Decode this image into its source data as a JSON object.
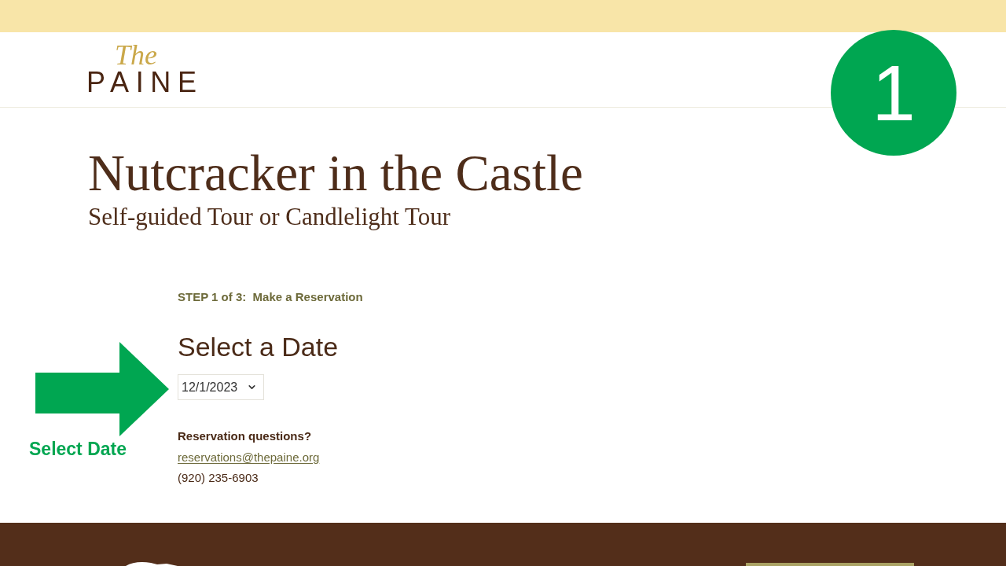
{
  "header": {
    "logo": {
      "script": "The",
      "wordmark": "PAINE"
    }
  },
  "step_marker": "1",
  "page": {
    "title": "Nutcracker in the Castle",
    "subtitle": "Self-guided Tour or Candlelight Tour"
  },
  "reservation": {
    "step_label": "STEP 1 of 3:  Make a Reservation",
    "heading": "Select a Date",
    "date_select": {
      "value": "12/1/2023"
    },
    "questions_label": "Reservation questions?",
    "email": "reservations@thepaine.org",
    "phone": "(920) 235-6903"
  },
  "annotation": {
    "label": "Select Date"
  }
}
